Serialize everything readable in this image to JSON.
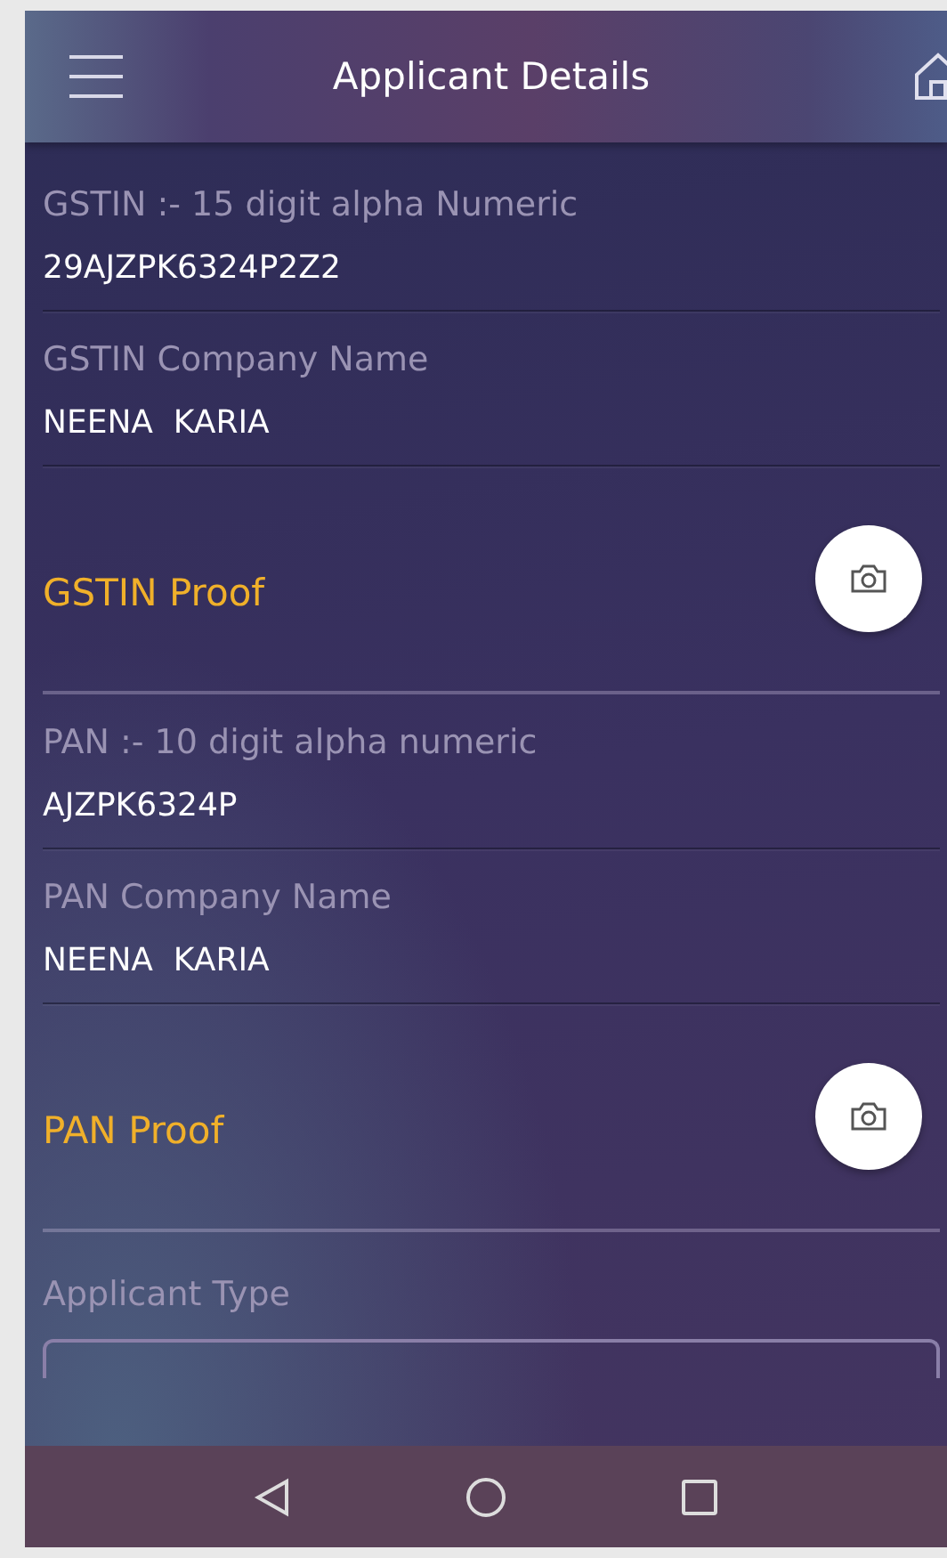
{
  "header": {
    "title": "Applicant Details"
  },
  "fields": [
    {
      "kind": "text",
      "label": "GSTIN :- 15 digit alpha Numeric",
      "value": "29AJZPK6324P2Z2"
    },
    {
      "kind": "text",
      "label": "GSTIN Company Name",
      "value": "NEENA  KARIA"
    },
    {
      "kind": "proof",
      "label": "GSTIN Proof"
    },
    {
      "kind": "text",
      "label": "PAN :- 10 digit alpha numeric",
      "value": "AJZPK6324P"
    },
    {
      "kind": "text",
      "label": "PAN Company Name",
      "value": "NEENA  KARIA"
    },
    {
      "kind": "proof",
      "label": "PAN Proof"
    },
    {
      "kind": "select",
      "label": "Applicant Type"
    }
  ]
}
